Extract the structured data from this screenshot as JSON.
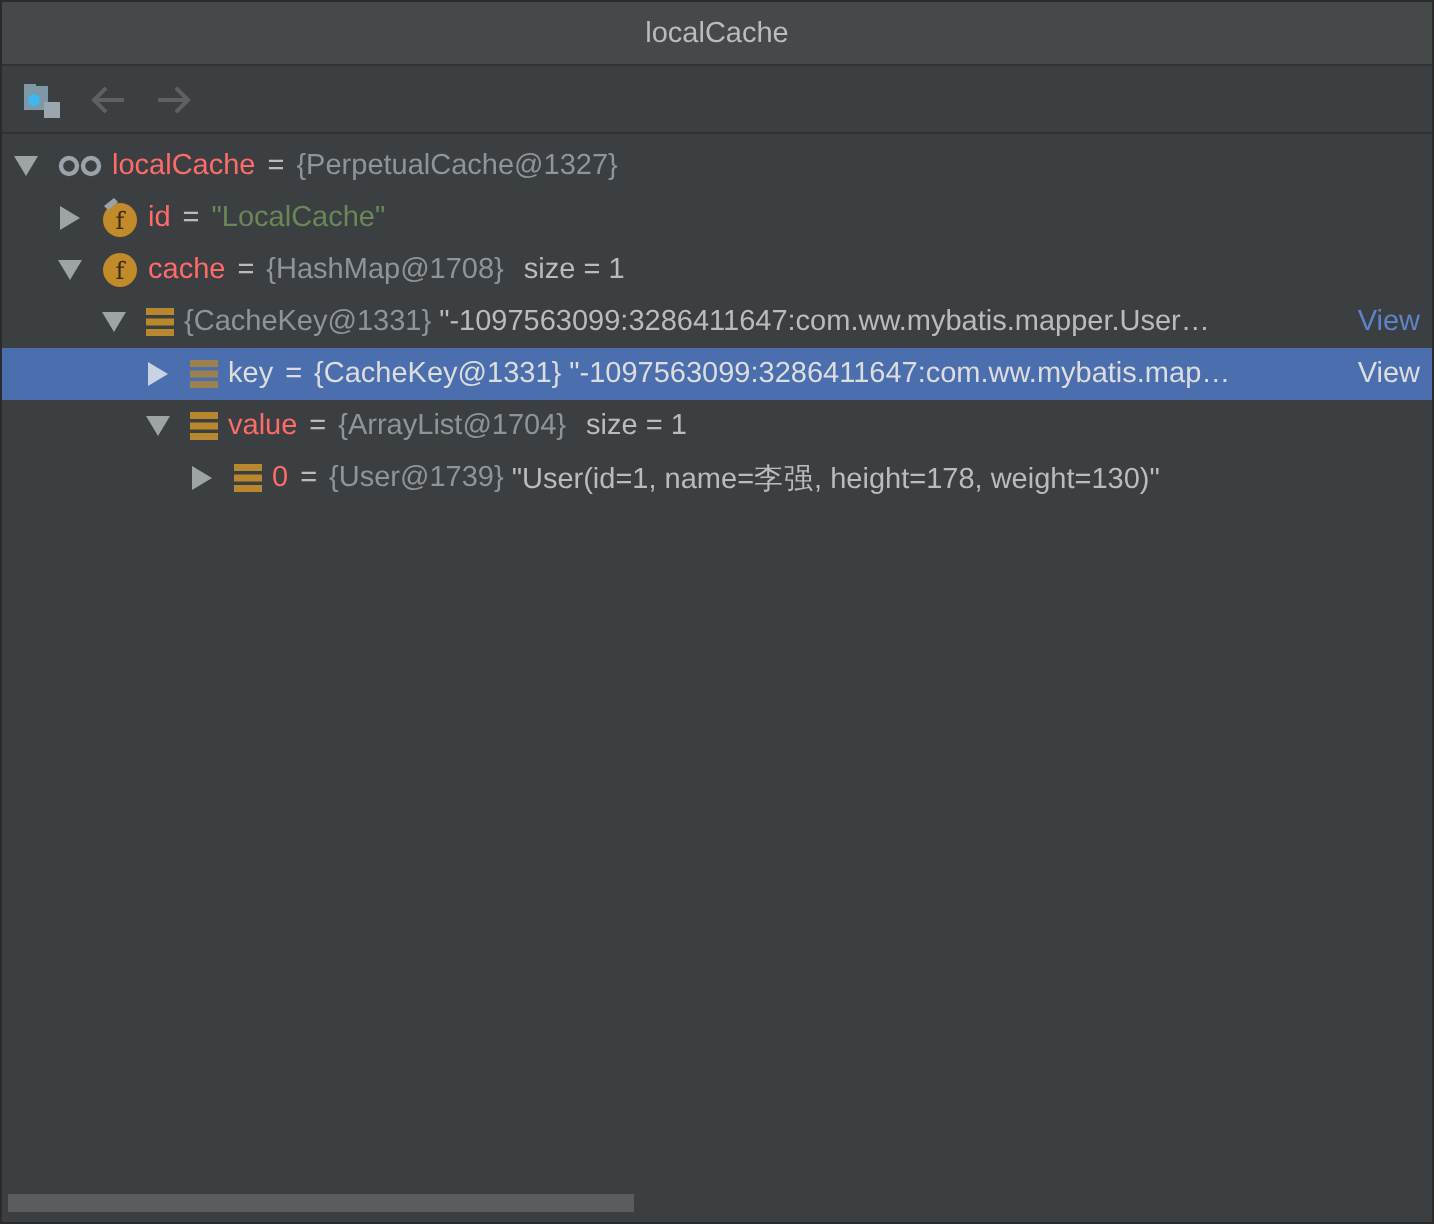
{
  "window": {
    "title": "localCache"
  },
  "toolbar": {
    "back_disabled": true,
    "forward_disabled": true
  },
  "tree": [
    {
      "kind": "watch",
      "expanded": true,
      "selected": false,
      "name": "localCache",
      "equals": "=",
      "type": "{PerpetualCache@1327}",
      "children": [
        {
          "kind": "field-final",
          "icon_letter": "f",
          "expanded": false,
          "selected": false,
          "name": "id",
          "equals": "=",
          "string": "\"LocalCache\""
        },
        {
          "kind": "field",
          "icon_letter": "f",
          "expanded": true,
          "selected": false,
          "name": "cache",
          "equals": "=",
          "type": "{HashMap@1708}",
          "size": "size = 1",
          "children": [
            {
              "kind": "entry",
              "expanded": true,
              "selected": false,
              "type": "{CacheKey@1331}",
              "text": "\"-1097563099:3286411647:com.ww.mybatis.mapper.User…",
              "link": "View",
              "children": [
                {
                  "kind": "entry",
                  "expanded": false,
                  "selected": true,
                  "name": "key",
                  "equals": "=",
                  "type": "{CacheKey@1331}",
                  "text": "\"-1097563099:3286411647:com.ww.mybatis.map…",
                  "link": "View"
                },
                {
                  "kind": "entry",
                  "expanded": true,
                  "selected": false,
                  "name": "value",
                  "equals": "=",
                  "type": "{ArrayList@1704}",
                  "size": "size = 1",
                  "children": [
                    {
                      "kind": "entry",
                      "expanded": false,
                      "selected": false,
                      "name": "0",
                      "equals": "=",
                      "type": "{User@1739}",
                      "text": "\"User(id=1, name=李强, height=178, weight=130)\""
                    }
                  ]
                }
              ]
            }
          ]
        }
      ]
    }
  ]
}
